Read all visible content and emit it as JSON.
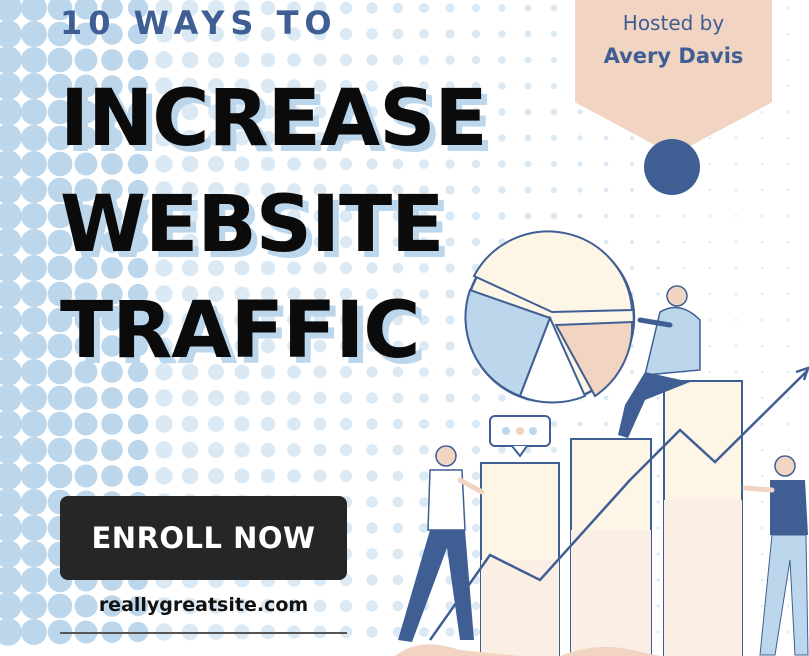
{
  "poster": {
    "kicker": "10 WAYS TO",
    "headline_lines": [
      "INCREASE",
      "WEBSITE",
      "TRAFFIC"
    ],
    "host_label": "Hosted by",
    "host_name": "Avery Davis",
    "cta_label": "ENROLL NOW",
    "website": "reallygreatsite.com"
  },
  "colors": {
    "navy": "#3f5f94",
    "light_blue": "#bcd7ec",
    "peach": "#f2d4c2",
    "cream": "#fdf6e6",
    "dark": "#262626"
  },
  "icons": [
    "pie-chart-icon",
    "speech-bubble-icon",
    "trend-arrow-icon",
    "person-icon"
  ]
}
